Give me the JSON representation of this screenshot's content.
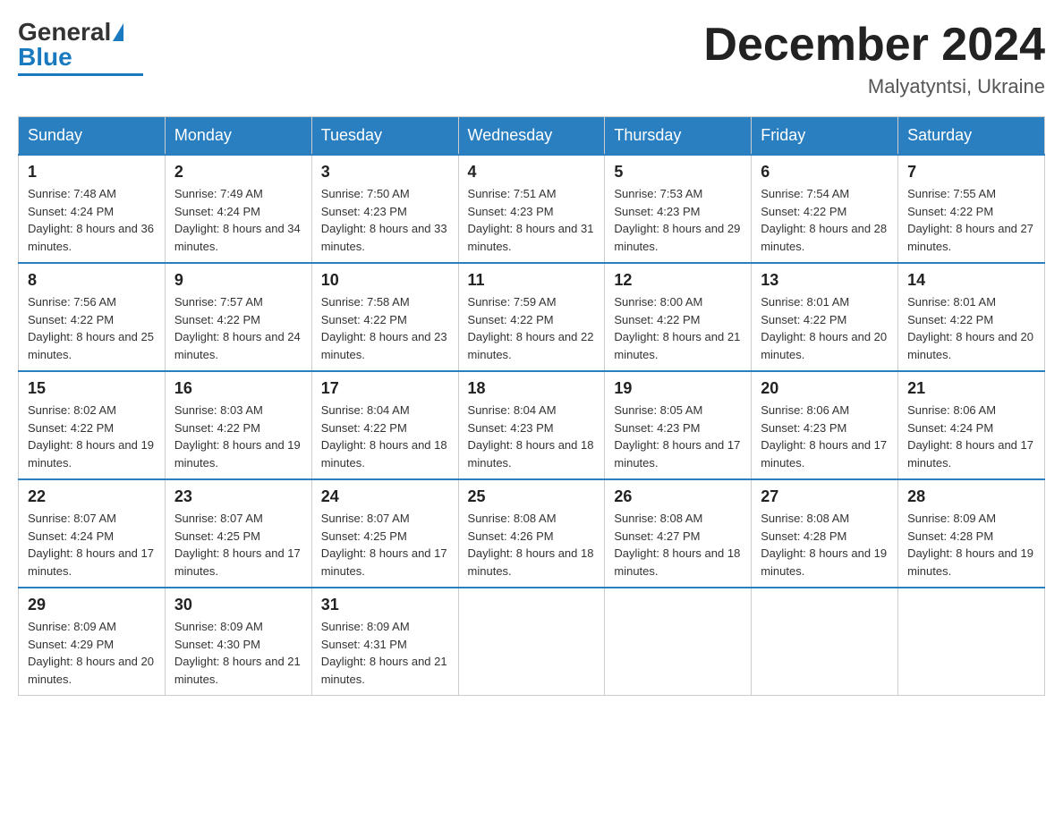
{
  "header": {
    "month_title": "December 2024",
    "location": "Malyatyntsi, Ukraine"
  },
  "days_of_week": [
    "Sunday",
    "Monday",
    "Tuesday",
    "Wednesday",
    "Thursday",
    "Friday",
    "Saturday"
  ],
  "weeks": [
    [
      {
        "day": "1",
        "sunrise": "7:48 AM",
        "sunset": "4:24 PM",
        "daylight": "8 hours and 36 minutes."
      },
      {
        "day": "2",
        "sunrise": "7:49 AM",
        "sunset": "4:24 PM",
        "daylight": "8 hours and 34 minutes."
      },
      {
        "day": "3",
        "sunrise": "7:50 AM",
        "sunset": "4:23 PM",
        "daylight": "8 hours and 33 minutes."
      },
      {
        "day": "4",
        "sunrise": "7:51 AM",
        "sunset": "4:23 PM",
        "daylight": "8 hours and 31 minutes."
      },
      {
        "day": "5",
        "sunrise": "7:53 AM",
        "sunset": "4:23 PM",
        "daylight": "8 hours and 29 minutes."
      },
      {
        "day": "6",
        "sunrise": "7:54 AM",
        "sunset": "4:22 PM",
        "daylight": "8 hours and 28 minutes."
      },
      {
        "day": "7",
        "sunrise": "7:55 AM",
        "sunset": "4:22 PM",
        "daylight": "8 hours and 27 minutes."
      }
    ],
    [
      {
        "day": "8",
        "sunrise": "7:56 AM",
        "sunset": "4:22 PM",
        "daylight": "8 hours and 25 minutes."
      },
      {
        "day": "9",
        "sunrise": "7:57 AM",
        "sunset": "4:22 PM",
        "daylight": "8 hours and 24 minutes."
      },
      {
        "day": "10",
        "sunrise": "7:58 AM",
        "sunset": "4:22 PM",
        "daylight": "8 hours and 23 minutes."
      },
      {
        "day": "11",
        "sunrise": "7:59 AM",
        "sunset": "4:22 PM",
        "daylight": "8 hours and 22 minutes."
      },
      {
        "day": "12",
        "sunrise": "8:00 AM",
        "sunset": "4:22 PM",
        "daylight": "8 hours and 21 minutes."
      },
      {
        "day": "13",
        "sunrise": "8:01 AM",
        "sunset": "4:22 PM",
        "daylight": "8 hours and 20 minutes."
      },
      {
        "day": "14",
        "sunrise": "8:01 AM",
        "sunset": "4:22 PM",
        "daylight": "8 hours and 20 minutes."
      }
    ],
    [
      {
        "day": "15",
        "sunrise": "8:02 AM",
        "sunset": "4:22 PM",
        "daylight": "8 hours and 19 minutes."
      },
      {
        "day": "16",
        "sunrise": "8:03 AM",
        "sunset": "4:22 PM",
        "daylight": "8 hours and 19 minutes."
      },
      {
        "day": "17",
        "sunrise": "8:04 AM",
        "sunset": "4:22 PM",
        "daylight": "8 hours and 18 minutes."
      },
      {
        "day": "18",
        "sunrise": "8:04 AM",
        "sunset": "4:23 PM",
        "daylight": "8 hours and 18 minutes."
      },
      {
        "day": "19",
        "sunrise": "8:05 AM",
        "sunset": "4:23 PM",
        "daylight": "8 hours and 17 minutes."
      },
      {
        "day": "20",
        "sunrise": "8:06 AM",
        "sunset": "4:23 PM",
        "daylight": "8 hours and 17 minutes."
      },
      {
        "day": "21",
        "sunrise": "8:06 AM",
        "sunset": "4:24 PM",
        "daylight": "8 hours and 17 minutes."
      }
    ],
    [
      {
        "day": "22",
        "sunrise": "8:07 AM",
        "sunset": "4:24 PM",
        "daylight": "8 hours and 17 minutes."
      },
      {
        "day": "23",
        "sunrise": "8:07 AM",
        "sunset": "4:25 PM",
        "daylight": "8 hours and 17 minutes."
      },
      {
        "day": "24",
        "sunrise": "8:07 AM",
        "sunset": "4:25 PM",
        "daylight": "8 hours and 17 minutes."
      },
      {
        "day": "25",
        "sunrise": "8:08 AM",
        "sunset": "4:26 PM",
        "daylight": "8 hours and 18 minutes."
      },
      {
        "day": "26",
        "sunrise": "8:08 AM",
        "sunset": "4:27 PM",
        "daylight": "8 hours and 18 minutes."
      },
      {
        "day": "27",
        "sunrise": "8:08 AM",
        "sunset": "4:28 PM",
        "daylight": "8 hours and 19 minutes."
      },
      {
        "day": "28",
        "sunrise": "8:09 AM",
        "sunset": "4:28 PM",
        "daylight": "8 hours and 19 minutes."
      }
    ],
    [
      {
        "day": "29",
        "sunrise": "8:09 AM",
        "sunset": "4:29 PM",
        "daylight": "8 hours and 20 minutes."
      },
      {
        "day": "30",
        "sunrise": "8:09 AM",
        "sunset": "4:30 PM",
        "daylight": "8 hours and 21 minutes."
      },
      {
        "day": "31",
        "sunrise": "8:09 AM",
        "sunset": "4:31 PM",
        "daylight": "8 hours and 21 minutes."
      },
      null,
      null,
      null,
      null
    ]
  ]
}
